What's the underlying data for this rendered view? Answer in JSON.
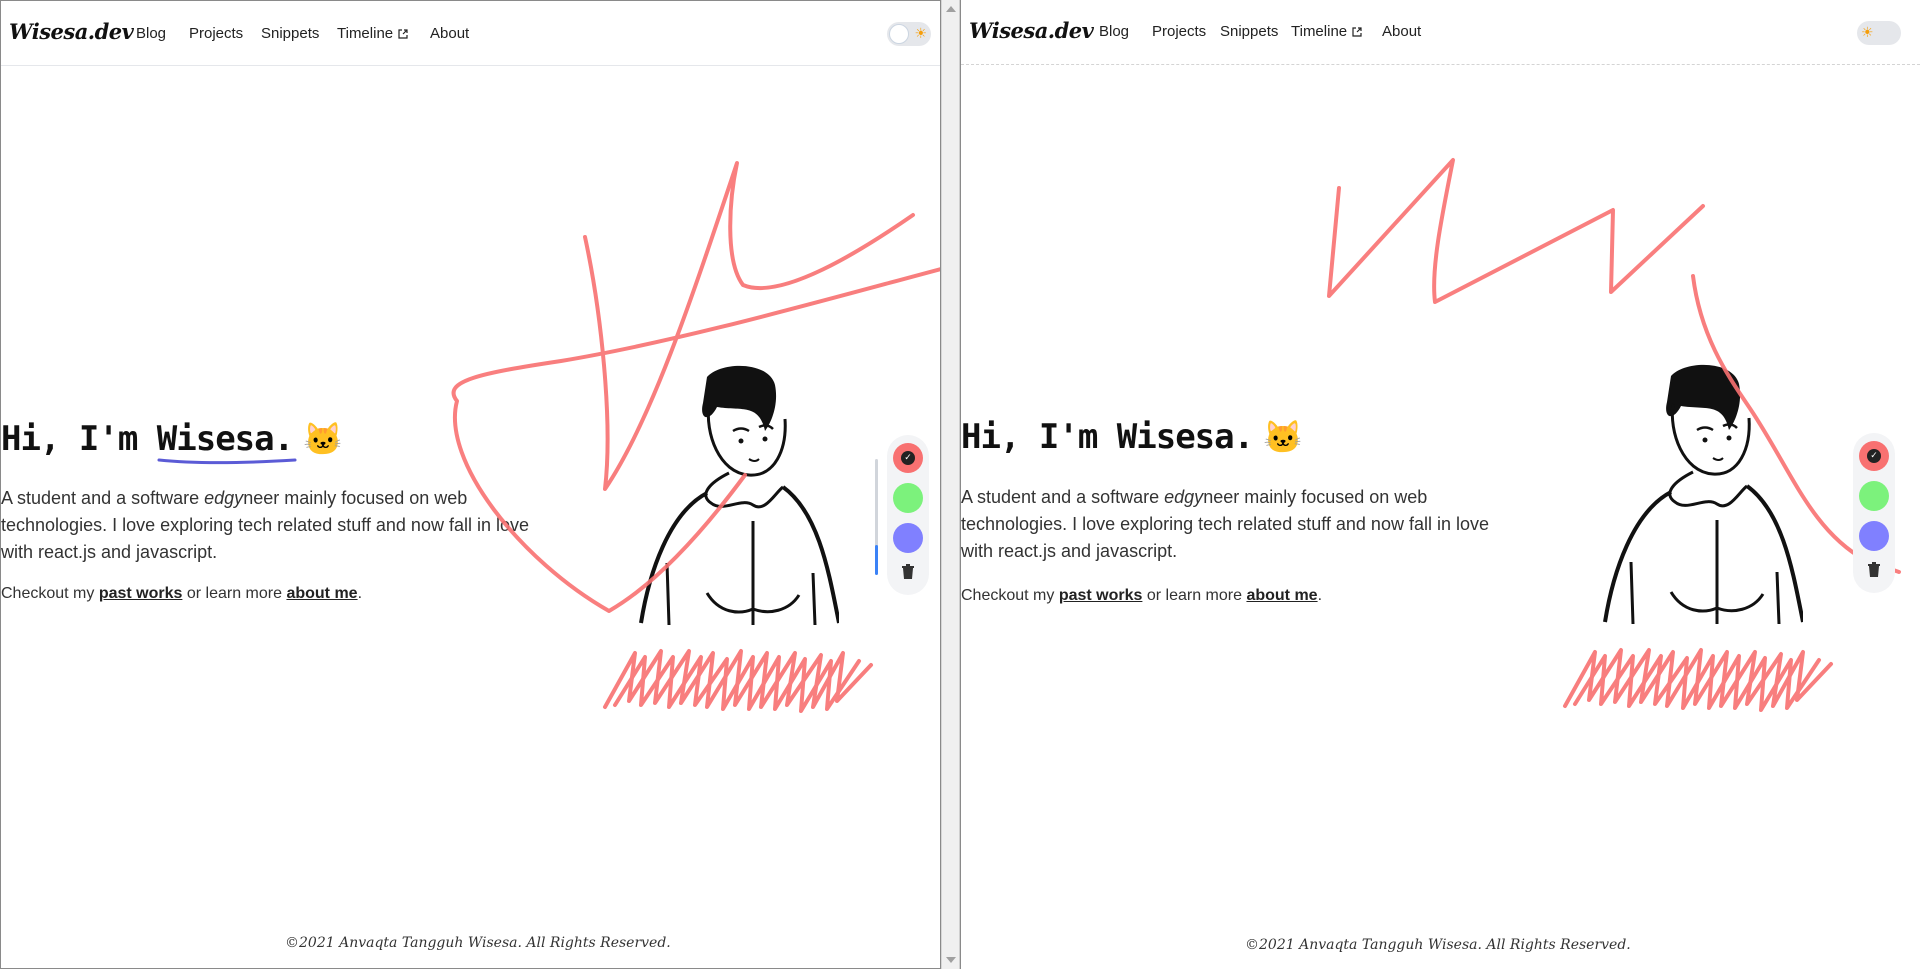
{
  "site": {
    "logo": "Wisesa.dev",
    "nav": [
      "Blog",
      "Projects",
      "Snippets",
      "Timeline",
      "About"
    ],
    "theme_icon": "sun-icon",
    "hero": {
      "greeting": "Hi, I'm",
      "name": "Wisesa.",
      "emoji": "🐱",
      "intro_before": "A student and a software ",
      "intro_em": "edgy",
      "intro_after": "neer mainly focused on web technologies. I love exploring tech related stuff and now fall in love with react.js and javascript.",
      "cta_prefix": "Checkout my ",
      "cta_link1": "past works",
      "cta_mid": " or learn more ",
      "cta_link2": "about me",
      "cta_suffix": "."
    },
    "palette": {
      "colors": [
        "#f87171",
        "#7cf27c",
        "#8080ff"
      ],
      "selected": "#f87171"
    },
    "footer": "©2021 Anvaqta Tangguh Wisesa. All Rights Reserved."
  }
}
